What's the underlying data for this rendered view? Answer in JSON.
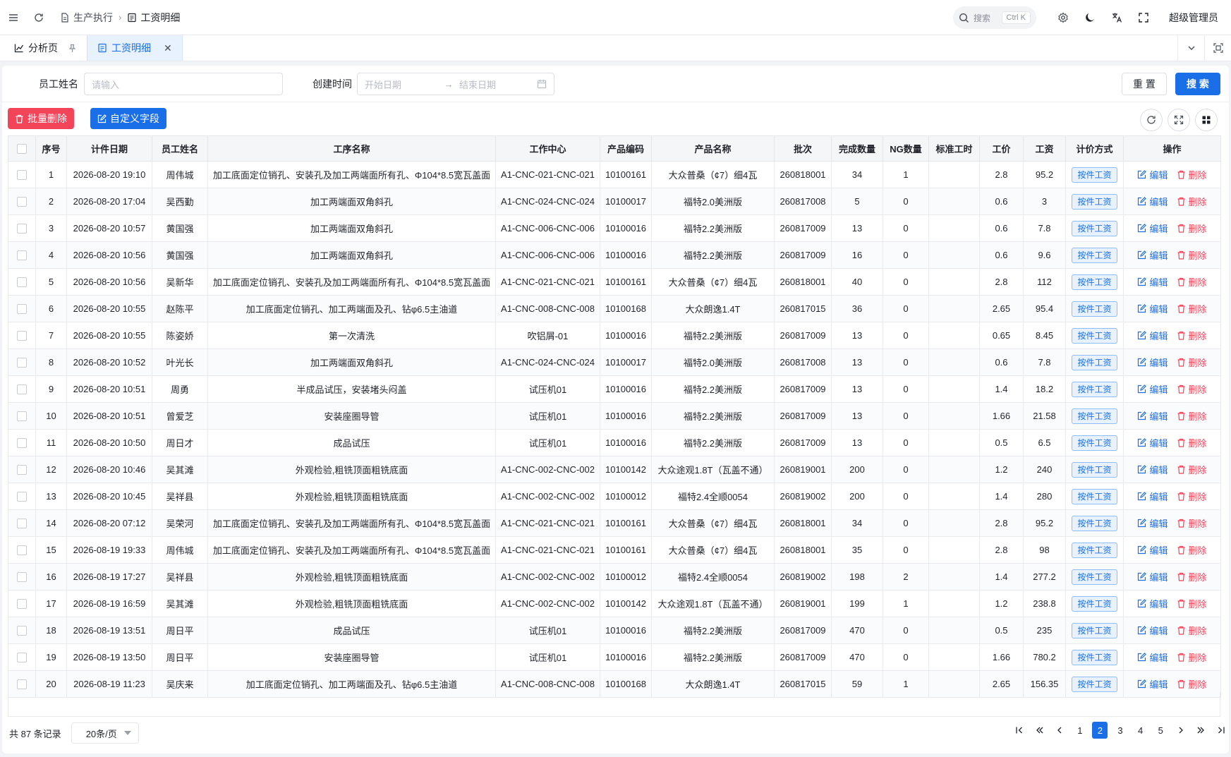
{
  "header": {
    "breadcrumb": [
      "生产执行",
      "工资明细"
    ],
    "search_placeholder": "搜索",
    "search_shortcut": "Ctrl K",
    "user": "超级管理员"
  },
  "tabs": [
    {
      "label": "分析页",
      "pinned": true,
      "active": false
    },
    {
      "label": "工资明细",
      "pinned": false,
      "active": true
    }
  ],
  "filters": {
    "employee_label": "员工姓名",
    "employee_placeholder": "请输入",
    "created_label": "创建时间",
    "start_placeholder": "开始日期",
    "end_placeholder": "结束日期",
    "reset": "重 置",
    "search": "搜 索"
  },
  "toolbar": {
    "batch_delete": "批量删除",
    "custom_fields": "自定义字段"
  },
  "columns": [
    "序号",
    "计件日期",
    "员工姓名",
    "工序名称",
    "工作中心",
    "产品编码",
    "产品名称",
    "批次",
    "完成数量",
    "NG数量",
    "标准工时",
    "工价",
    "工资",
    "计价方式",
    "操作"
  ],
  "actions": {
    "edit": "编辑",
    "delete": "删除"
  },
  "rows": [
    [
      "1",
      "2026-08-20 19:10",
      "周伟城",
      "加工底面定位销孔、安装孔及加工两端面所有孔、Φ104*8.5宽瓦盖面",
      "A1-CNC-021-CNC-021",
      "10100161",
      "大众普桑（¢7）细4瓦",
      "260818001",
      "34",
      "1",
      "",
      "2.8",
      "95.2",
      "按件工资"
    ],
    [
      "2",
      "2026-08-20 17:04",
      "吴西勤",
      "加工两端面双角斜孔",
      "A1-CNC-024-CNC-024",
      "10100017",
      "福特2.0美洲版",
      "260817008",
      "5",
      "0",
      "",
      "0.6",
      "3",
      "按件工资"
    ],
    [
      "3",
      "2026-08-20 10:57",
      "黄国强",
      "加工两端面双角斜孔",
      "A1-CNC-006-CNC-006",
      "10100016",
      "福特2.2美洲版",
      "260817009",
      "13",
      "0",
      "",
      "0.6",
      "7.8",
      "按件工资"
    ],
    [
      "4",
      "2026-08-20 10:56",
      "黄国强",
      "加工两端面双角斜孔",
      "A1-CNC-006-CNC-006",
      "10100016",
      "福特2.2美洲版",
      "260817009",
      "16",
      "0",
      "",
      "0.6",
      "9.6",
      "按件工资"
    ],
    [
      "5",
      "2026-08-20 10:56",
      "吴新华",
      "加工底面定位销孔、安装孔及加工两端面所有孔、Φ104*8.5宽瓦盖面",
      "A1-CNC-021-CNC-021",
      "10100161",
      "大众普桑（¢7）细4瓦",
      "260818001",
      "40",
      "0",
      "",
      "2.8",
      "112",
      "按件工资"
    ],
    [
      "6",
      "2026-08-20 10:55",
      "赵陈平",
      "加工底面定位销孔、加工两端面及孔、钻φ6.5主油道",
      "A1-CNC-008-CNC-008",
      "10100168",
      "大众朗逸1.4T",
      "260817015",
      "36",
      "0",
      "",
      "2.65",
      "95.4",
      "按件工资"
    ],
    [
      "7",
      "2026-08-20 10:55",
      "陈姿娇",
      "第一次清洗",
      "吹铝屑-01",
      "10100016",
      "福特2.2美洲版",
      "260817009",
      "13",
      "0",
      "",
      "0.65",
      "8.45",
      "按件工资"
    ],
    [
      "8",
      "2026-08-20 10:52",
      "叶光长",
      "加工两端面双角斜孔",
      "A1-CNC-024-CNC-024",
      "10100017",
      "福特2.0美洲版",
      "260817008",
      "13",
      "0",
      "",
      "0.6",
      "7.8",
      "按件工资"
    ],
    [
      "9",
      "2026-08-20 10:51",
      "周勇",
      "半成品试压，安装堵头闷盖",
      "试压机01",
      "10100016",
      "福特2.2美洲版",
      "260817009",
      "13",
      "0",
      "",
      "1.4",
      "18.2",
      "按件工资"
    ],
    [
      "10",
      "2026-08-20 10:51",
      "曾爱芝",
      "安装座圈导管",
      "试压机01",
      "10100016",
      "福特2.2美洲版",
      "260817009",
      "13",
      "0",
      "",
      "1.66",
      "21.58",
      "按件工资"
    ],
    [
      "11",
      "2026-08-20 10:50",
      "周日才",
      "成品试压",
      "试压机01",
      "10100016",
      "福特2.2美洲版",
      "260817009",
      "13",
      "0",
      "",
      "0.5",
      "6.5",
      "按件工资"
    ],
    [
      "12",
      "2026-08-20 10:46",
      "吴其滩",
      "外观检验,粗铣顶面粗铣底面",
      "A1-CNC-002-CNC-002",
      "10100142",
      "大众途观1.8T（瓦盖不通）",
      "260819001",
      "200",
      "0",
      "",
      "1.2",
      "240",
      "按件工资"
    ],
    [
      "13",
      "2026-08-20 10:45",
      "吴祥县",
      "外观检验,粗铣顶面粗铣底面",
      "A1-CNC-002-CNC-002",
      "10100012",
      "福特2.4全顺0054",
      "260819002",
      "200",
      "0",
      "",
      "1.4",
      "280",
      "按件工资"
    ],
    [
      "14",
      "2026-08-20 07:12",
      "吴荣河",
      "加工底面定位销孔、安装孔及加工两端面所有孔、Φ104*8.5宽瓦盖面",
      "A1-CNC-021-CNC-021",
      "10100161",
      "大众普桑（¢7）细4瓦",
      "260818001",
      "34",
      "0",
      "",
      "2.8",
      "95.2",
      "按件工资"
    ],
    [
      "15",
      "2026-08-19 19:33",
      "周伟城",
      "加工底面定位销孔、安装孔及加工两端面所有孔、Φ104*8.5宽瓦盖面",
      "A1-CNC-021-CNC-021",
      "10100161",
      "大众普桑（¢7）细4瓦",
      "260818001",
      "35",
      "0",
      "",
      "2.8",
      "98",
      "按件工资"
    ],
    [
      "16",
      "2026-08-19 17:27",
      "吴祥县",
      "外观检验,粗铣顶面粗铣底面",
      "A1-CNC-002-CNC-002",
      "10100012",
      "福特2.4全顺0054",
      "260819002",
      "198",
      "2",
      "",
      "1.4",
      "277.2",
      "按件工资"
    ],
    [
      "17",
      "2026-08-19 16:59",
      "吴其滩",
      "外观检验,粗铣顶面粗铣底面",
      "A1-CNC-002-CNC-002",
      "10100142",
      "大众途观1.8T（瓦盖不通）",
      "260819001",
      "199",
      "1",
      "",
      "1.2",
      "238.8",
      "按件工资"
    ],
    [
      "18",
      "2026-08-19 13:51",
      "周日平",
      "成品试压",
      "试压机01",
      "10100016",
      "福特2.2美洲版",
      "260817009",
      "470",
      "0",
      "",
      "0.5",
      "235",
      "按件工资"
    ],
    [
      "19",
      "2026-08-19 13:50",
      "周日平",
      "安装座圈导管",
      "试压机01",
      "10100016",
      "福特2.2美洲版",
      "260817009",
      "470",
      "0",
      "",
      "1.66",
      "780.2",
      "按件工资"
    ],
    [
      "20",
      "2026-08-19 11:23",
      "吴庆来",
      "加工底面定位销孔、加工两端面及孔、钻φ6.5主油道",
      "A1-CNC-008-CNC-008",
      "10100168",
      "大众朗逸1.4T",
      "260817015",
      "59",
      "1",
      "",
      "2.65",
      "156.35",
      "按件工资"
    ]
  ],
  "pagination": {
    "total_text": "共 87 条记录",
    "page_size": "20条/页",
    "pages": [
      "1",
      "2",
      "3",
      "4",
      "5"
    ],
    "current": "2"
  },
  "colors": {
    "primary": "#1a6fe8",
    "danger": "#f3445a",
    "tag_bg": "#e8f1fe"
  }
}
